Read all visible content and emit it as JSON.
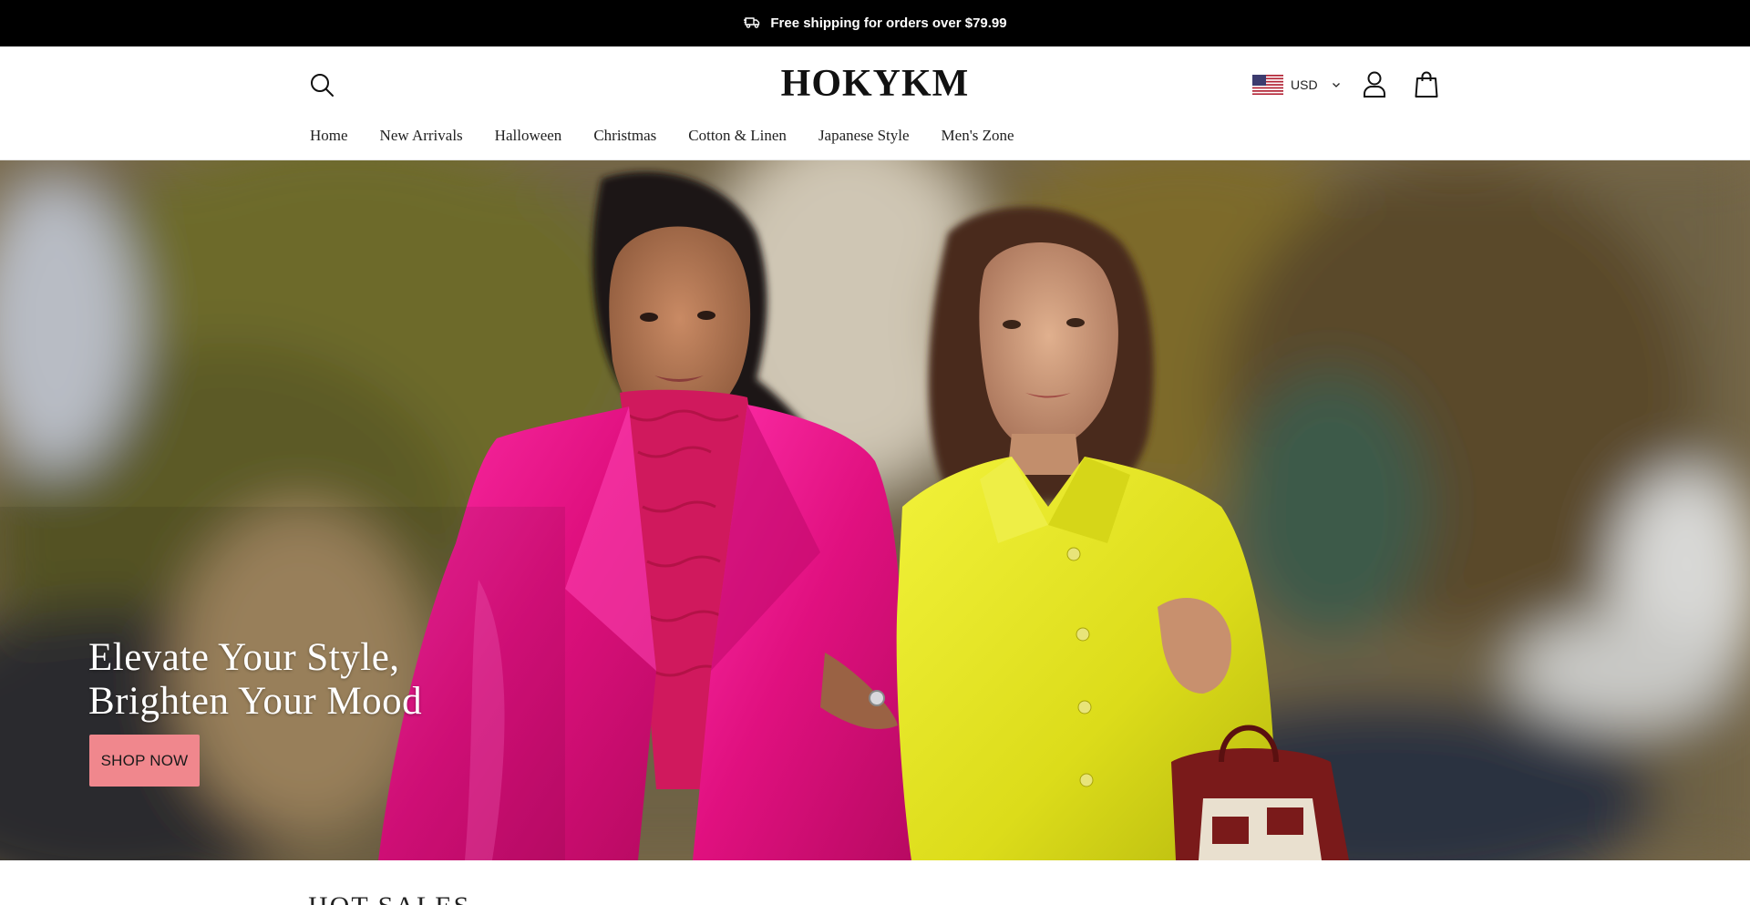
{
  "announcement": {
    "text": "Free shipping for orders over $79.99",
    "icon": "delivery-truck-icon"
  },
  "header": {
    "logo": "HOKYKM",
    "currency": {
      "code": "USD",
      "flag": "us-flag-icon"
    },
    "icons": [
      "search-icon",
      "account-icon",
      "cart-bag-icon"
    ]
  },
  "nav": {
    "items": [
      {
        "label": "Home"
      },
      {
        "label": "New Arrivals"
      },
      {
        "label": "Halloween"
      },
      {
        "label": "Christmas"
      },
      {
        "label": "Cotton & Linen"
      },
      {
        "label": "Japanese Style"
      },
      {
        "label": "Men's Zone"
      }
    ]
  },
  "hero": {
    "headline_line1": "Elevate Your Style,",
    "headline_line2": "Brighten Your Mood",
    "cta_label": "SHOP NOW",
    "cta_color": "#f0878d"
  },
  "next_section": {
    "title_partial": "HOT SALES"
  }
}
